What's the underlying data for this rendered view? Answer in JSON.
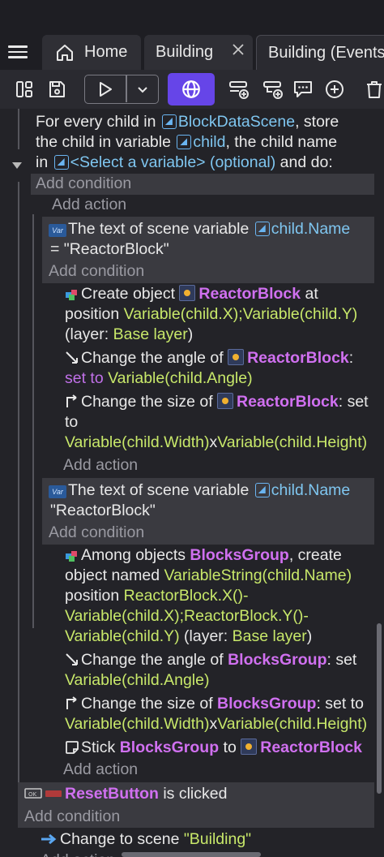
{
  "tabs": [
    {
      "label": "Home"
    },
    {
      "label": "Building"
    },
    {
      "label": "Building (Events)"
    }
  ],
  "toolbar": {
    "icons": [
      "layout-icon",
      "save-icon",
      "play-icon",
      "chevron-down-icon",
      "globe-icon",
      "add-event-icon",
      "add-subevent-icon",
      "add-comment-icon",
      "add-icon",
      "delete-icon"
    ]
  },
  "events": {
    "foreach": {
      "l1a": "For every child in ",
      "l1b": "BlockDataScene",
      "l1c": ", store",
      "l2a": "the child in variable ",
      "l2b": "child",
      "l2c": ", the child name",
      "l3a": "in ",
      "l3b": "<Select a variable> (optional)",
      "l3c": " and do:",
      "add_condition": "Add condition",
      "add_action": "Add action"
    },
    "sub1": {
      "cond_a": "The text of scene variable ",
      "cond_b": "child.Name",
      "cond_c": "= \"ReactorBlock\"",
      "add_condition": "Add condition",
      "a1_a": "Create object ",
      "a1_b": "ReactorBlock",
      "a1_c": " at",
      "a1_d": "position ",
      "a1_e": "Variable(child.X);Variable(child.Y)",
      "a1_f": "(layer: ",
      "a1_g": "Base layer",
      "a1_h": ")",
      "a2_a": "Change the angle of ",
      "a2_b": "ReactorBlock",
      "a2_c": ":",
      "a2_d": "set to ",
      "a2_e": "Variable(child.Angle)",
      "a3_a": "Change the size of ",
      "a3_b": "ReactorBlock",
      "a3_c": ": set",
      "a3_d": "to",
      "a3_e": "Variable(child.Width)",
      "a3_f": "x",
      "a3_g": "Variable(child.Height)",
      "add_action": "Add action"
    },
    "sub2": {
      "cond_a": "The text of scene variable ",
      "cond_b": "child.Name",
      "cond_c": "\"ReactorBlock\"",
      "add_condition": "Add condition",
      "a1_a": "Among objects ",
      "a1_b": "BlocksGroup",
      "a1_c": ", create",
      "a1_d": "object named ",
      "a1_e": "VariableString(child.Name)",
      "a1_f": "position ",
      "a1_g": "ReactorBlock.X()-",
      "a1_h": "Variable(child.X);ReactorBlock.Y()-",
      "a1_i": "Variable(child.Y)",
      "a1_j": " (layer: ",
      "a1_k": "Base layer",
      "a1_l": ")",
      "a2_a": "Change the angle of ",
      "a2_b": "BlocksGroup",
      "a2_c": ": set",
      "a2_d": "Variable(child.Angle)",
      "a3_a": "Change the size of ",
      "a3_b": "BlocksGroup",
      "a3_c": ": set to",
      "a3_d": "Variable(child.Width)",
      "a3_e": "x",
      "a3_f": "Variable(child.Height)",
      "a4_a": "Stick ",
      "a4_b": "BlocksGroup",
      "a4_c": " to ",
      "a4_d": "ReactorBlock",
      "add_action": "Add action"
    },
    "reset": {
      "cond_a": "ResetButton",
      "cond_b": " is clicked",
      "add_condition": "Add condition",
      "a1_a": "Change to scene ",
      "a1_b": "\"Building\"",
      "add_action": "Add action"
    }
  },
  "colors": {
    "accent": "#6645e8",
    "expression": "#c8e86a",
    "variable": "#7fc6f0",
    "object": "#d070f0"
  }
}
